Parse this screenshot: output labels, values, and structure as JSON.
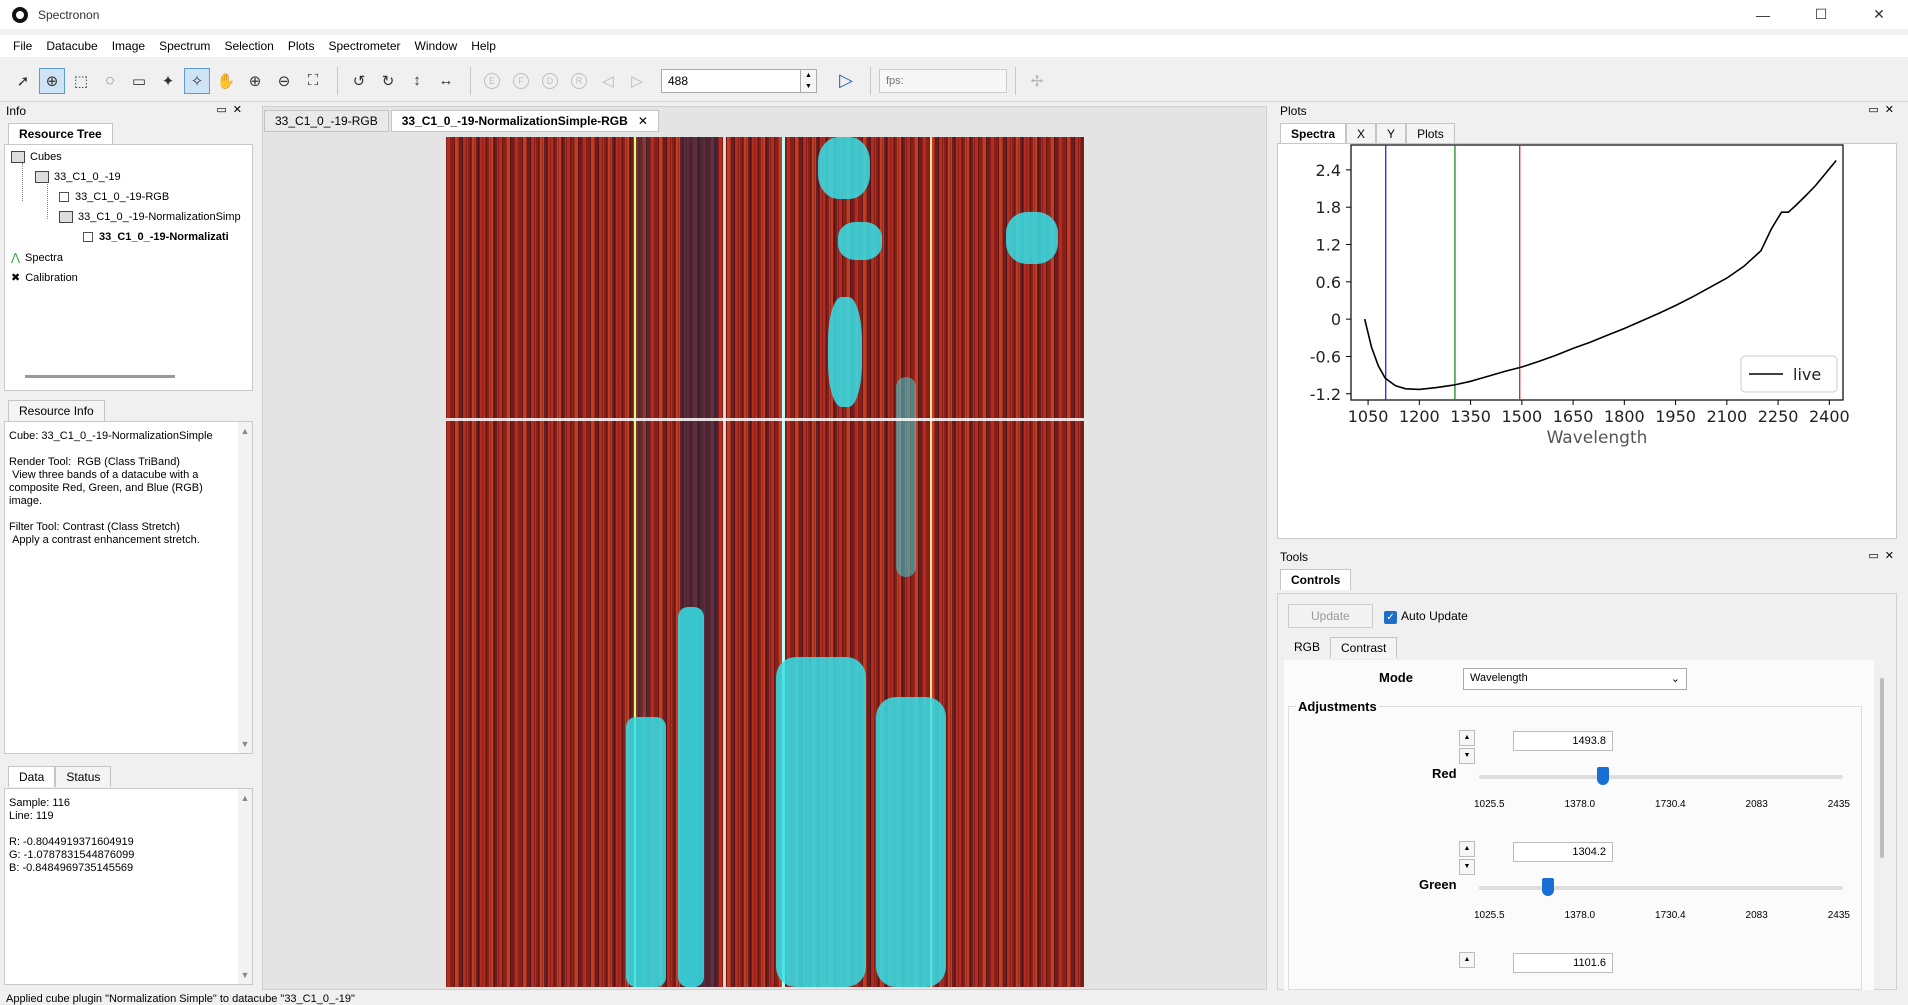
{
  "app": {
    "title": "Spectronon"
  },
  "window_controls": {
    "minimize": "—",
    "maximize": "☐",
    "close": "✕"
  },
  "menu": [
    "File",
    "Datacube",
    "Image",
    "Spectrum",
    "Selection",
    "Plots",
    "Spectrometer",
    "Window",
    "Help"
  ],
  "toolbar": {
    "frame_value": "488",
    "fps_placeholder": "fps:",
    "letter_buttons": [
      "E",
      "F",
      "D",
      "R"
    ]
  },
  "info_panel": {
    "title": "Info",
    "resource_tree_tab": "Resource Tree",
    "tree": {
      "cubes": "Cubes",
      "cube": "33_C1_0_-19",
      "rgb": "33_C1_0_-19-RGB",
      "norm": "33_C1_0_-19-NormalizationSimp",
      "norm_rgb": "33_C1_0_-19-Normalizati",
      "spectra": "Spectra",
      "calibration": "Calibration"
    },
    "resource_info_tab": "Resource Info",
    "resource_info_text": "Cube: 33_C1_0_-19-NormalizationSimple\n\nRender Tool:  RGB (Class TriBand)\n View three bands of a datacube with a\ncomposite Red, Green, and Blue (RGB)\nimage.\n\nFilter Tool: Contrast (Class Stretch)\n Apply a contrast enhancement stretch.",
    "data_tab": "Data",
    "status_tab": "Status",
    "data_text": "Sample: 116\nLine: 119\n\nR: -0.8044919371604919\nG: -1.0787831544876099\nB: -0.8484969735145569"
  },
  "image_tabs": {
    "tab1": "33_C1_0_-19-RGB",
    "tab2": "33_C1_0_-19-NormalizationSimple-RGB",
    "close": "✕"
  },
  "plots_panel": {
    "title": "Plots",
    "tabs": [
      "Spectra",
      "X",
      "Y",
      "Plots"
    ],
    "legend_label": "live"
  },
  "chart_data": {
    "type": "line",
    "xlabel": "Wavelength",
    "ylabel": "",
    "xlim": [
      1000,
      2440
    ],
    "ylim": [
      -1.3,
      2.8
    ],
    "x_ticks": [
      1050,
      1200,
      1350,
      1500,
      1650,
      1800,
      1950,
      2100,
      2250,
      2400
    ],
    "y_ticks": [
      2.4,
      1.8,
      1.2,
      0.6,
      0,
      -0.6,
      -1.2
    ],
    "y_tick_labels": [
      "2.4",
      "1.8",
      "1.2",
      "0.6",
      "0",
      "-0.6",
      "-1.2"
    ],
    "series": [
      {
        "name": "live",
        "color": "#000000",
        "x": [
          1040,
          1060,
          1080,
          1100,
          1130,
          1160,
          1200,
          1250,
          1300,
          1350,
          1400,
          1450,
          1500,
          1550,
          1600,
          1650,
          1700,
          1750,
          1800,
          1850,
          1900,
          1950,
          2000,
          2050,
          2100,
          2150,
          2200,
          2230,
          2260,
          2280,
          2300,
          2330,
          2360,
          2390,
          2420
        ],
        "y": [
          0.0,
          -0.45,
          -0.75,
          -0.95,
          -1.07,
          -1.12,
          -1.13,
          -1.1,
          -1.06,
          -1.0,
          -0.92,
          -0.84,
          -0.77,
          -0.68,
          -0.58,
          -0.47,
          -0.37,
          -0.26,
          -0.15,
          -0.03,
          0.09,
          0.22,
          0.36,
          0.51,
          0.66,
          0.85,
          1.1,
          1.45,
          1.72,
          1.72,
          1.82,
          1.98,
          2.15,
          2.35,
          2.55
        ]
      }
    ],
    "vertical_lines": [
      {
        "x": 1101.6,
        "color": "#2929d8"
      },
      {
        "x": 1304.2,
        "color": "#1f8a1f"
      },
      {
        "x": 1493.8,
        "color": "#e02020"
      }
    ],
    "legend": "bottom-right",
    "grid": false
  },
  "tools_panel": {
    "title": "Tools",
    "controls_tab": "Controls",
    "update_button": "Update",
    "auto_update_label": "Auto Update",
    "auto_update_checked": true,
    "sub_tabs": [
      "RGB",
      "Contrast"
    ],
    "mode_label": "Mode",
    "mode_value": "Wavelength",
    "adjustments_label": "Adjustments",
    "red": {
      "label": "Red",
      "value": "1493.8",
      "fraction": 0.34
    },
    "green": {
      "label": "Green",
      "value": "1304.2",
      "fraction": 0.19
    },
    "blue": {
      "value": "1101.6"
    },
    "slider_ticks": [
      "1025.5",
      "1378.0",
      "1730.4",
      "2083",
      "2435"
    ]
  },
  "status_bar": {
    "message": "Applied cube plugin \"Normalization Simple\" to datacube \"33_C1_0_-19\""
  }
}
